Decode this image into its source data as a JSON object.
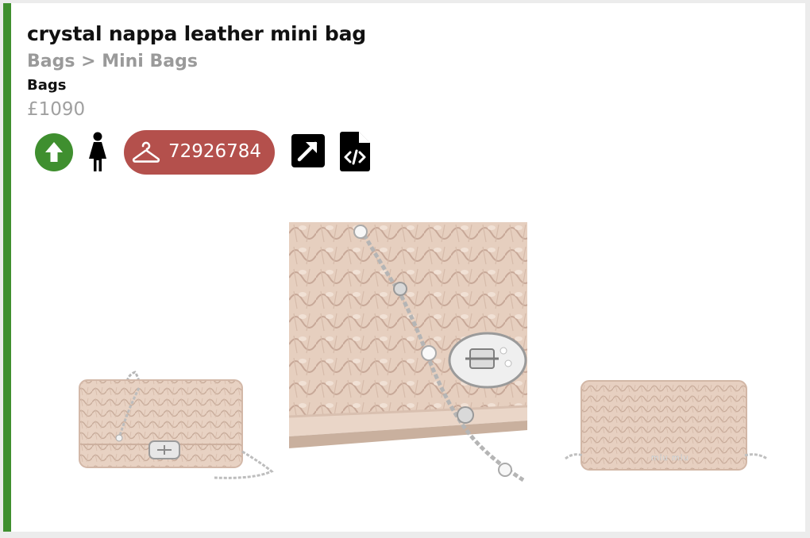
{
  "product": {
    "title": "crystal nappa leather mini bag",
    "breadcrumb": "Bags > Mini Bags",
    "category": "Bags",
    "price": "£1090"
  },
  "actions": {
    "sku": "72926784",
    "icons": [
      "arrow-up-icon",
      "female-icon",
      "hanger-icon",
      "external-link-icon",
      "code-file-icon"
    ]
  },
  "colors": {
    "accent_bar": "#3f8f2f",
    "upvote_button": "#3f8f2f",
    "sku_pill": "#b4504c",
    "leather": "#e6cfc0"
  },
  "images": [
    {
      "name": "product-image-front"
    },
    {
      "name": "product-image-closeup"
    },
    {
      "name": "product-image-back"
    }
  ]
}
